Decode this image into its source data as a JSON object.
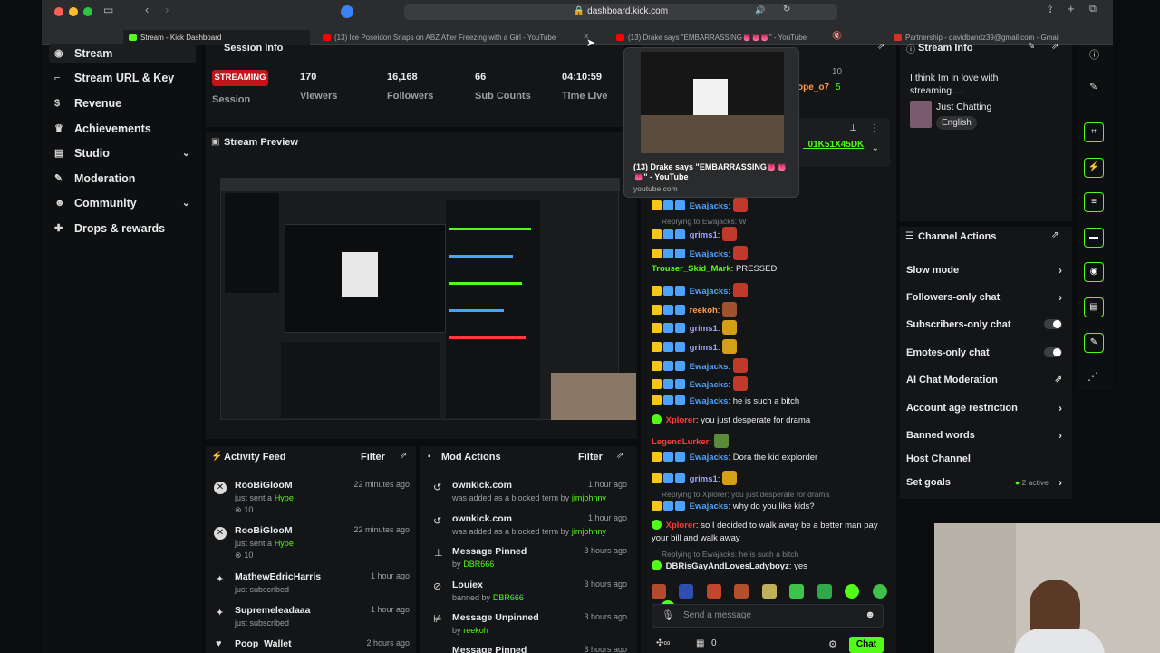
{
  "browser": {
    "url": "dashboard.kick.com",
    "tabs": [
      {
        "label": "Stream - Kick Dashboard"
      },
      {
        "label": "(13) Ice Poseidon Snaps on ABZ After Freezing with a Girl - YouTube"
      },
      {
        "label": "(13) Drake says \"EMBARRASSING👅👅👅\" - YouTube"
      },
      {
        "label": "Partnership - davidbandz39@gmail.com - Gmail"
      }
    ]
  },
  "tab_preview": {
    "title": "(13) Drake says \"EMBARRASSING👅👅👅\" - YouTube",
    "domain": "youtube.com"
  },
  "sidebar": {
    "items": [
      {
        "label": "Stream",
        "icon": "radio-icon"
      },
      {
        "label": "Stream URL & Key",
        "icon": "key-icon"
      },
      {
        "label": "Revenue",
        "icon": "dollar-icon"
      },
      {
        "label": "Achievements",
        "icon": "trophy-icon"
      },
      {
        "label": "Studio",
        "icon": "studio-icon"
      },
      {
        "label": "Moderation",
        "icon": "wrench-icon"
      },
      {
        "label": "Community",
        "icon": "people-icon"
      },
      {
        "label": "Drops & rewards",
        "icon": "gift-icon"
      }
    ]
  },
  "session": {
    "title": "Session Info",
    "status": "STREAMING",
    "status_label": "Session",
    "stats": [
      {
        "value": "170",
        "label": "Viewers"
      },
      {
        "value": "16,168",
        "label": "Followers"
      },
      {
        "value": "66",
        "label": "Sub Counts"
      },
      {
        "value": "04:10:59",
        "label": "Time Live"
      }
    ]
  },
  "preview": {
    "title": "Stream Preview"
  },
  "activity": {
    "title": "Activity Feed",
    "filter": "Filter",
    "items": [
      {
        "name": "RooBiGlooM",
        "action": "just sent a",
        "highlight": "Hype",
        "count": "10",
        "time": "22 minutes ago"
      },
      {
        "name": "RooBiGlooM",
        "action": "just sent a",
        "highlight": "Hype",
        "count": "10",
        "time": "22 minutes ago"
      },
      {
        "name": "MathewEdricHarris",
        "action": "just subscribed",
        "time": "1 hour ago"
      },
      {
        "name": "Supremeleadaaa",
        "action": "just subscribed",
        "time": "1 hour ago"
      },
      {
        "name": "Poop_Wallet",
        "time": "2 hours ago"
      }
    ]
  },
  "mod": {
    "title": "Mod Actions",
    "filter": "Filter",
    "items": [
      {
        "name": "ownkick.com",
        "desc": "was added as a blocked term by",
        "by": "jimjohnny",
        "time": "1 hour ago"
      },
      {
        "name": "ownkick.com",
        "desc": "was added as a blocked term by",
        "by": "jimjohnny",
        "time": "1 hour ago"
      },
      {
        "name": "Message Pinned",
        "desc": "by",
        "by": "DBR666",
        "time": "3 hours ago"
      },
      {
        "name": "Louiex",
        "desc": "banned by",
        "by": "DBR666",
        "time": "3 hours ago"
      },
      {
        "name": "Message Unpinned",
        "desc": "by",
        "by": "reekoh",
        "time": "3 hours ago"
      },
      {
        "name": "Message Pinned",
        "time": "3 hours ago"
      }
    ]
  },
  "chat": {
    "header_counts": [
      "10",
      "5"
    ],
    "header_user": "ope_o7",
    "pinned": "_01K51X45DK",
    "reply_hint": "Replying to Ewajacks: W",
    "lines": [
      {
        "user": "Ewajacks",
        "color": "#4ba3ff",
        "text": ""
      },
      {
        "user": "grims1",
        "color": "#9ea7ff",
        "text": ""
      },
      {
        "user": "Ewajacks",
        "color": "#4ba3ff",
        "text": ""
      },
      {
        "user": "Trouser_Skid_Mark",
        "color": "#53fc18",
        "text": "PRESSED"
      },
      {
        "user": "Ewajacks",
        "color": "#4ba3ff",
        "text": ""
      },
      {
        "user": "reekoh",
        "color": "#ff9d4a",
        "text": ""
      },
      {
        "user": "grims1",
        "color": "#9ea7ff",
        "text": ""
      },
      {
        "user": "grims1",
        "color": "#9ea7ff",
        "text": ""
      },
      {
        "user": "Ewajacks",
        "color": "#4ba3ff",
        "text": ""
      },
      {
        "user": "Ewajacks",
        "color": "#4ba3ff",
        "text": ""
      },
      {
        "user": "Ewajacks",
        "color": "#4ba3ff",
        "text": "he is such a bitch"
      },
      {
        "user": "Xplorer",
        "color": "#ff3b3b",
        "text": "you just desperate for drama"
      },
      {
        "user": "LegendLurker",
        "color": "#ff3b3b",
        "text": ""
      },
      {
        "user": "Ewajacks",
        "color": "#4ba3ff",
        "text": "Dora the kid explorder"
      },
      {
        "user": "grims1",
        "color": "#9ea7ff",
        "text": ""
      }
    ],
    "reply1": "Replying to Xplorer: you just desperate for drama",
    "line_why": {
      "user": "Ewajacks",
      "text": "why do you like kids?"
    },
    "line_walk": {
      "user": "Xplorer",
      "text": "so I decided to walk away be a better man pay your bill and walk away"
    },
    "reply2": "Replying to Ewajacks: he is such a bitch",
    "line_last": {
      "user": "DBRisGayAndLovesLadyboyz",
      "text": "yes"
    },
    "input_placeholder": "Send a message",
    "counts_a": "0",
    "send": "Chat"
  },
  "stream_info": {
    "title": "Stream Info",
    "stream_title": "I think Im in love with streaming.....",
    "category": "Just Chatting",
    "language": "English"
  },
  "channel_actions": {
    "title": "Channel Actions",
    "items": [
      {
        "label": "Slow mode",
        "kind": "arrow"
      },
      {
        "label": "Followers-only chat",
        "kind": "arrow"
      },
      {
        "label": "Subscribers-only chat",
        "kind": "toggle"
      },
      {
        "label": "Emotes-only chat",
        "kind": "toggle"
      },
      {
        "label": "AI Chat Moderation",
        "kind": "link"
      },
      {
        "label": "Account age restriction",
        "kind": "arrow"
      },
      {
        "label": "Banned words",
        "kind": "arrow"
      },
      {
        "label": "Host Channel",
        "kind": "none"
      },
      {
        "label": "Set goals",
        "kind": "arrow",
        "extra": "2 active"
      }
    ]
  },
  "colors": {
    "kick_green": "#53fc18",
    "live_red": "#c0161b"
  }
}
